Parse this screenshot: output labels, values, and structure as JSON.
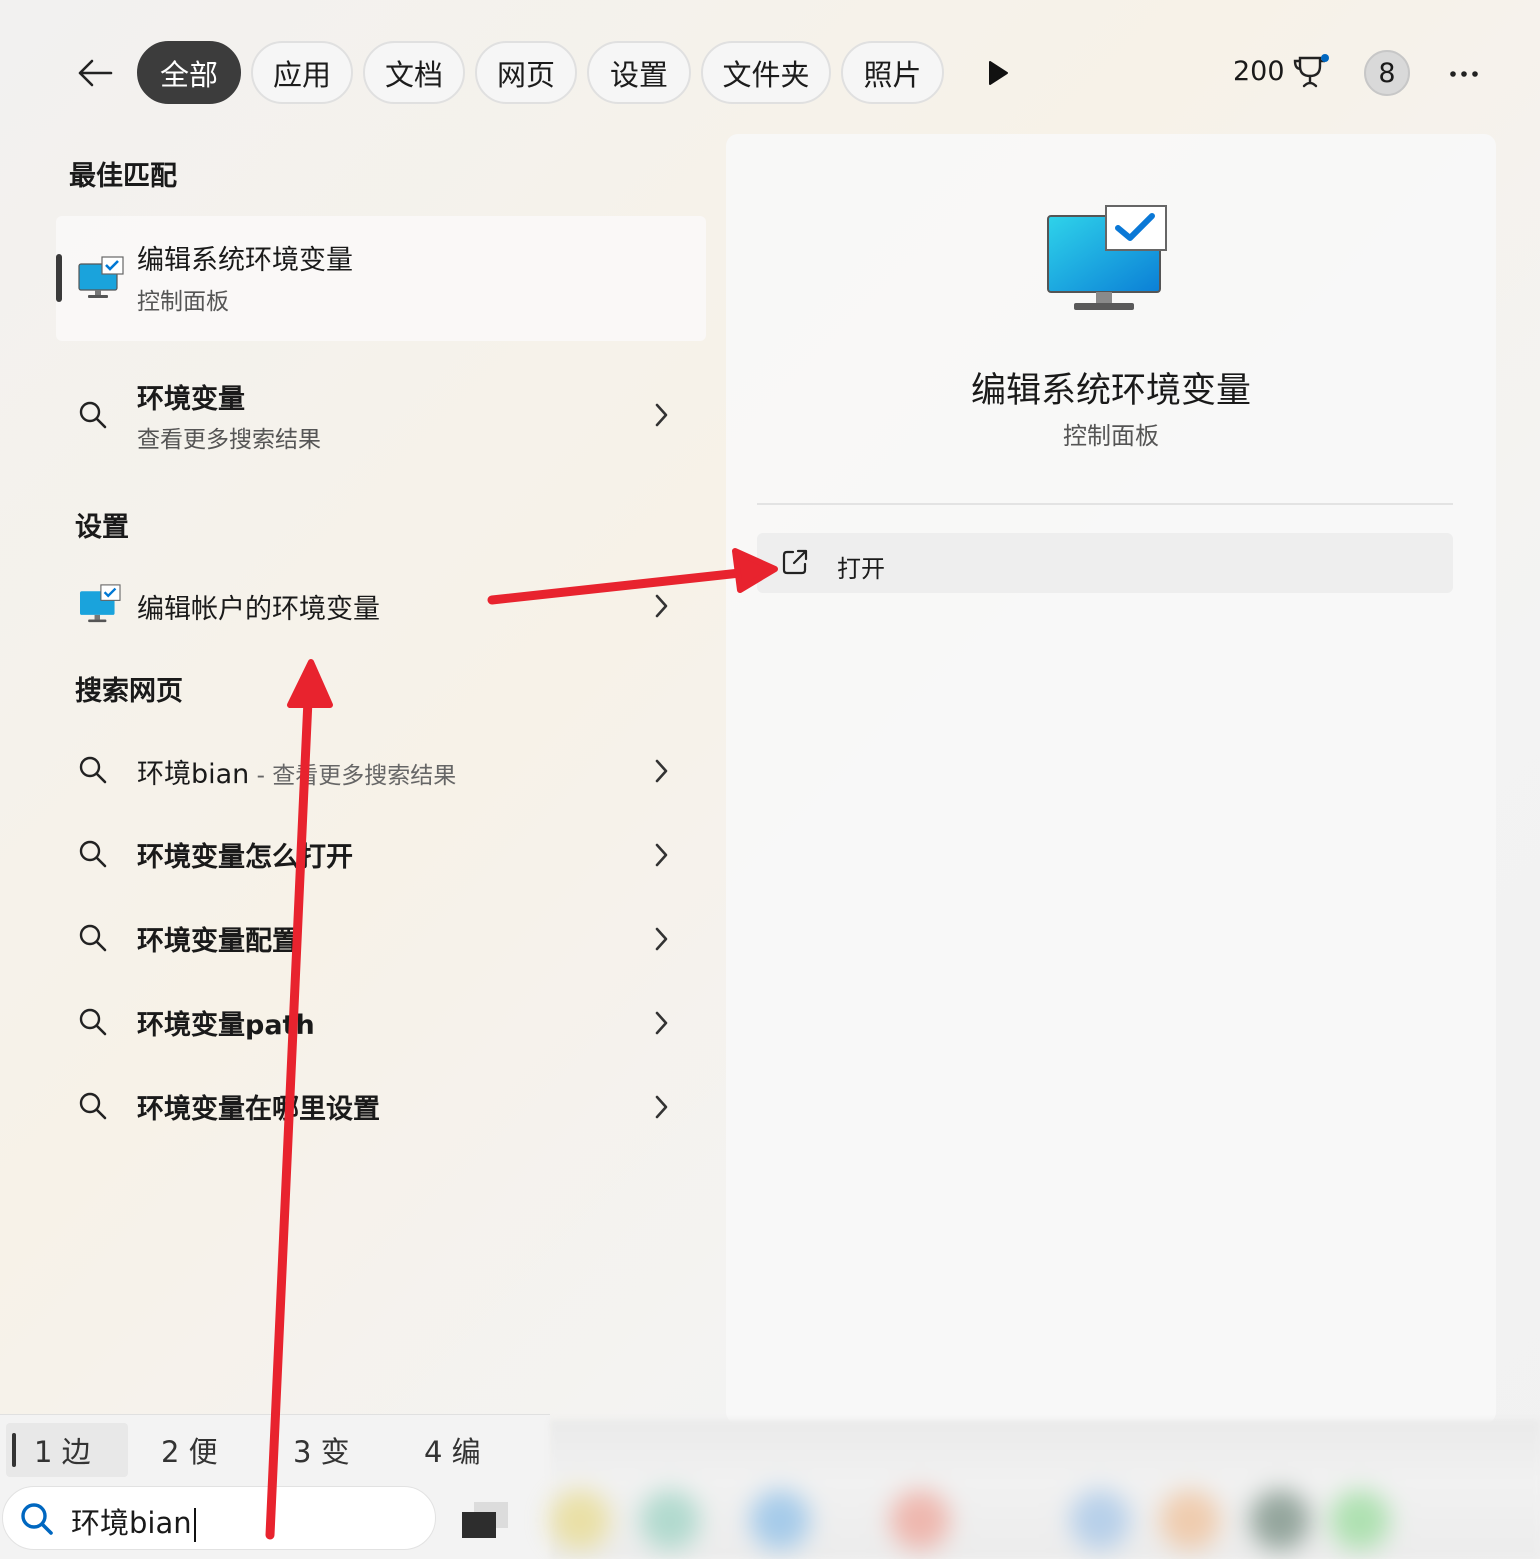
{
  "header": {
    "tabs": [
      "全部",
      "应用",
      "文档",
      "网页",
      "设置",
      "文件夹",
      "照片"
    ],
    "active_tab_index": 0,
    "points": "200",
    "avatar_label": "8"
  },
  "sections": {
    "best_match": "最佳匹配",
    "settings": "设置",
    "web_search": "搜索网页"
  },
  "best_match": {
    "title": "编辑系统环境变量",
    "subtitle": "控制面板"
  },
  "more_results": {
    "title": "环境变量",
    "subtitle": "查看更多搜索结果"
  },
  "settings_item": {
    "title": "编辑帐户的环境变量"
  },
  "web_results": {
    "first": {
      "query": "环境bian",
      "suffix": " - 查看更多搜索结果"
    },
    "items": [
      "环境变量怎么打开",
      "环境变量配置",
      "环境变量path",
      "环境变量在哪里设置"
    ]
  },
  "detail": {
    "title": "编辑系统环境变量",
    "subtitle": "控制面板",
    "open_label": "打开"
  },
  "ime": {
    "candidates": [
      "1 边",
      "2 便",
      "3 变",
      "4 编"
    ],
    "selected_index": 0
  },
  "search": {
    "value": "环境bian"
  },
  "colors": {
    "accent_blue": "#0067c0",
    "annotation_red": "#e8232e",
    "active_tab": "#3c3c3c"
  }
}
